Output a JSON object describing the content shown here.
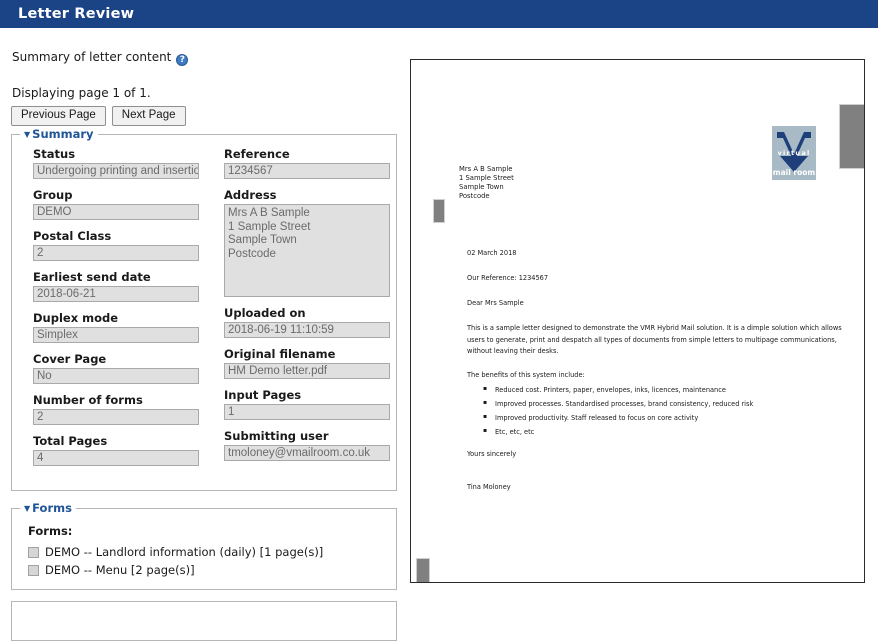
{
  "header": {
    "title": "Letter Review"
  },
  "subtitle": {
    "text": "Summary of letter content",
    "help_icon_glyph": "?"
  },
  "paging": {
    "status": "Displaying page 1 of 1.",
    "previous_label": "Previous Page",
    "next_label": "Next Page"
  },
  "summary": {
    "legend": "Summary",
    "left_fields": [
      {
        "label": "Status",
        "value": "Undergoing printing and insertion"
      },
      {
        "label": "Group",
        "value": "DEMO"
      },
      {
        "label": "Postal Class",
        "value": "2"
      },
      {
        "label": "Earliest send date",
        "value": "2018-06-21"
      },
      {
        "label": "Duplex mode",
        "value": "Simplex"
      },
      {
        "label": "Cover Page",
        "value": "No"
      },
      {
        "label": "Number of forms",
        "value": "2"
      },
      {
        "label": "Total Pages",
        "value": "4"
      }
    ],
    "right_fields": [
      {
        "label": "Reference",
        "value": "1234567"
      },
      {
        "label": "Address",
        "value": "Mrs A B Sample\n1 Sample Street\nSample Town\nPostcode"
      },
      {
        "label": "Uploaded on",
        "value": "2018-06-19 11:10:59"
      },
      {
        "label": "Original filename",
        "value": "HM Demo letter.pdf"
      },
      {
        "label": "Input Pages",
        "value": "1"
      },
      {
        "label": "Submitting user",
        "value": "tmoloney@vmailroom.co.uk"
      }
    ]
  },
  "forms": {
    "legend": "Forms",
    "heading": "Forms:",
    "items": [
      {
        "label": "DEMO -- Landlord information (daily) [1 page(s)]",
        "checked": false
      },
      {
        "label": "DEMO -- Menu [2 page(s)]",
        "checked": false
      }
    ]
  },
  "preview": {
    "logo": {
      "line1": "virtual",
      "line2": "mail room"
    },
    "recipient_address": "Mrs A B Sample\n1 Sample Street\nSample Town\nPostcode",
    "date": "02 March 2018",
    "reference_line": "Our Reference: 1234567",
    "salutation": "Dear Mrs Sample",
    "paragraph": "This is a sample letter designed to demonstrate the VMR Hybrid Mail solution.  It is a dimple solution which allows users to generate, print and despatch all types of documents from simple letters to multipage communications, without leaving their desks.",
    "benefits_intro": "The benefits of this system include:",
    "benefits": [
      "Reduced cost.  Printers, paper, envelopes, inks, licences, maintenance",
      "Improved processes.  Standardised processes, brand consistency, reduced risk",
      "Improved productivity.  Staff released to focus on core activity",
      "Etc, etc, etc"
    ],
    "signoff": "Yours sincerely",
    "signer": "Tina Moloney"
  },
  "colors": {
    "header_bg": "#1b4487",
    "legend_blue": "#1f5596",
    "field_value_bg": "#e0e0e0",
    "logo_bg": "#a8bac6",
    "logo_mark": "#1f3f7a",
    "gray_block": "#808080"
  }
}
